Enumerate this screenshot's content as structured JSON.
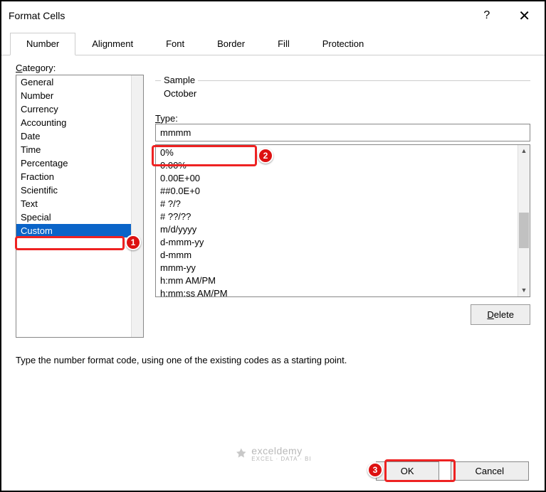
{
  "titlebar": {
    "title": "Format Cells",
    "help": "?",
    "close": "✕"
  },
  "tabs": [
    "Number",
    "Alignment",
    "Font",
    "Border",
    "Fill",
    "Protection"
  ],
  "active_tab_index": 0,
  "category_label": "Category:",
  "categories": [
    "General",
    "Number",
    "Currency",
    "Accounting",
    "Date",
    "Time",
    "Percentage",
    "Fraction",
    "Scientific",
    "Text",
    "Special",
    "Custom"
  ],
  "selected_category_index": 11,
  "sample": {
    "label": "Sample",
    "value": "October"
  },
  "type": {
    "label": "Type:",
    "value": "mmmm"
  },
  "type_list": [
    "0%",
    "0.00%",
    "0.00E+00",
    "##0.0E+0",
    "# ?/?",
    "# ??/??",
    "m/d/yyyy",
    "d-mmm-yy",
    "d-mmm",
    "mmm-yy",
    "h:mm AM/PM",
    "h:mm:ss AM/PM"
  ],
  "delete_label": "Delete",
  "hint": "Type the number format code, using one of the existing codes as a starting point.",
  "footer": {
    "ok": "OK",
    "cancel": "Cancel"
  },
  "watermark": {
    "brand": "exceldemy",
    "tagline": "EXCEL · DATA · BI"
  },
  "callouts": {
    "1": "1",
    "2": "2",
    "3": "3"
  }
}
